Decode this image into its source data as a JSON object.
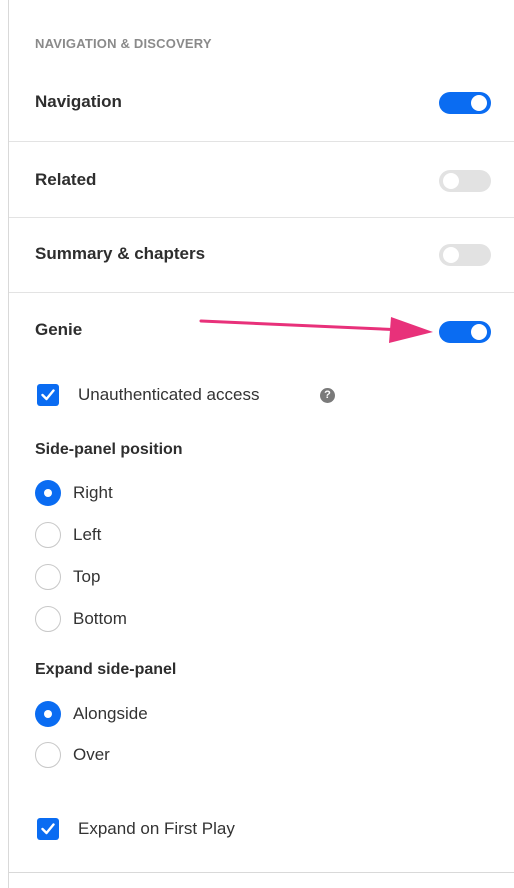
{
  "section": {
    "title": "NAVIGATION & DISCOVERY"
  },
  "rows": [
    {
      "label": "Navigation",
      "toggle": "on"
    },
    {
      "label": "Related",
      "toggle": "off"
    },
    {
      "label": "Summary & chapters",
      "toggle": "off"
    },
    {
      "label": "Genie",
      "toggle": "on"
    }
  ],
  "genie": {
    "unauthenticated_access": {
      "label": "Unauthenticated access",
      "checked": true,
      "help_icon": "question-icon",
      "help_glyph": "?"
    },
    "side_panel_position": {
      "heading": "Side-panel position",
      "options": [
        "Right",
        "Left",
        "Top",
        "Bottom"
      ],
      "selected": "Right"
    },
    "expand_side_panel": {
      "heading": "Expand side-panel",
      "options": [
        "Alongside",
        "Over"
      ],
      "selected": "Alongside"
    },
    "expand_on_first_play": {
      "label": "Expand on First Play",
      "checked": true
    }
  },
  "annotation": {
    "arrow_color": "#e8317a"
  },
  "colors": {
    "accent": "#0a6cf2",
    "toggle_off": "#e2e2e2"
  }
}
